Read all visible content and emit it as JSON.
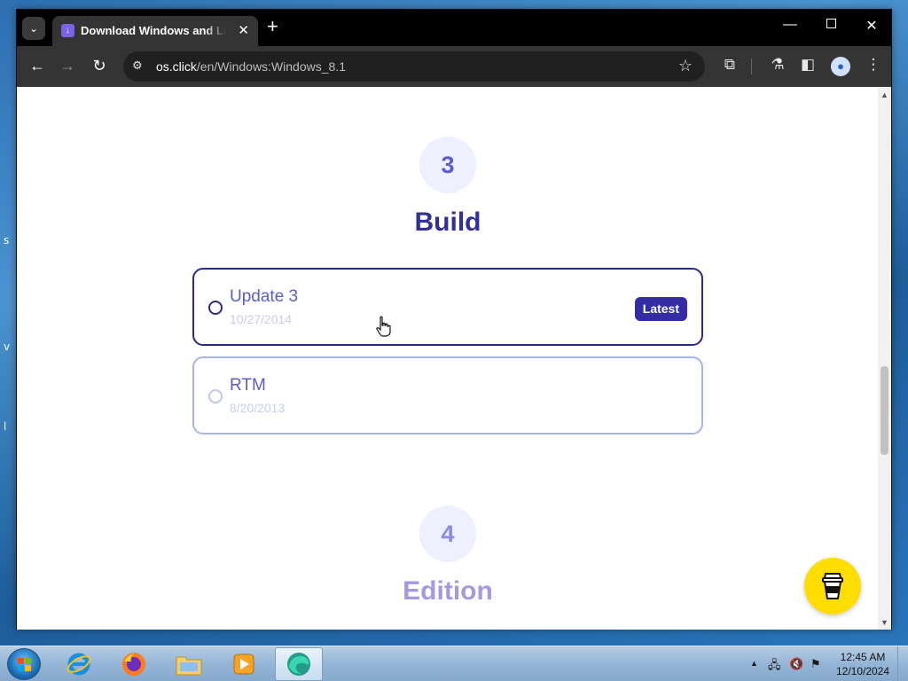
{
  "desktop": {
    "edge_glyphs": [
      "s",
      "v",
      "l"
    ]
  },
  "browser": {
    "tab_title": "Download Windows and Linux",
    "url_host": "os.click",
    "url_path": "/en/Windows:Windows_8.1",
    "icons": {
      "tab_list": "chevron-down-icon",
      "favicon": "download-icon",
      "tab_close": "close-icon",
      "new_tab": "plus-icon",
      "back": "arrow-left-icon",
      "forward": "arrow-right-icon",
      "reload": "reload-icon",
      "site_info": "tune-icon",
      "bookmark": "star-icon",
      "extensions": "puzzle-icon",
      "labs": "flask-icon",
      "side_panel": "sidepanel-icon",
      "profile": "profile-icon",
      "menu": "kebab-icon"
    }
  },
  "page": {
    "step3": {
      "number": "3",
      "title": "Build"
    },
    "options": [
      {
        "name": "Update 3",
        "date": "10/27/2014",
        "badge": "Latest"
      },
      {
        "name": "RTM",
        "date": "8/20/2013"
      }
    ],
    "step4": {
      "number": "4",
      "title": "Edition"
    },
    "coffee_icon": "coffee-cup-icon"
  },
  "taskbar": {
    "time": "12:45 AM",
    "date": "12/10/2024",
    "apps": [
      "internet-explorer-icon",
      "firefox-icon",
      "file-explorer-icon",
      "media-player-icon",
      "edge-browser-icon"
    ]
  },
  "colors": {
    "accent": "#332ca5",
    "step_bg": "#eef0ff",
    "coffee": "#ffdd00"
  }
}
